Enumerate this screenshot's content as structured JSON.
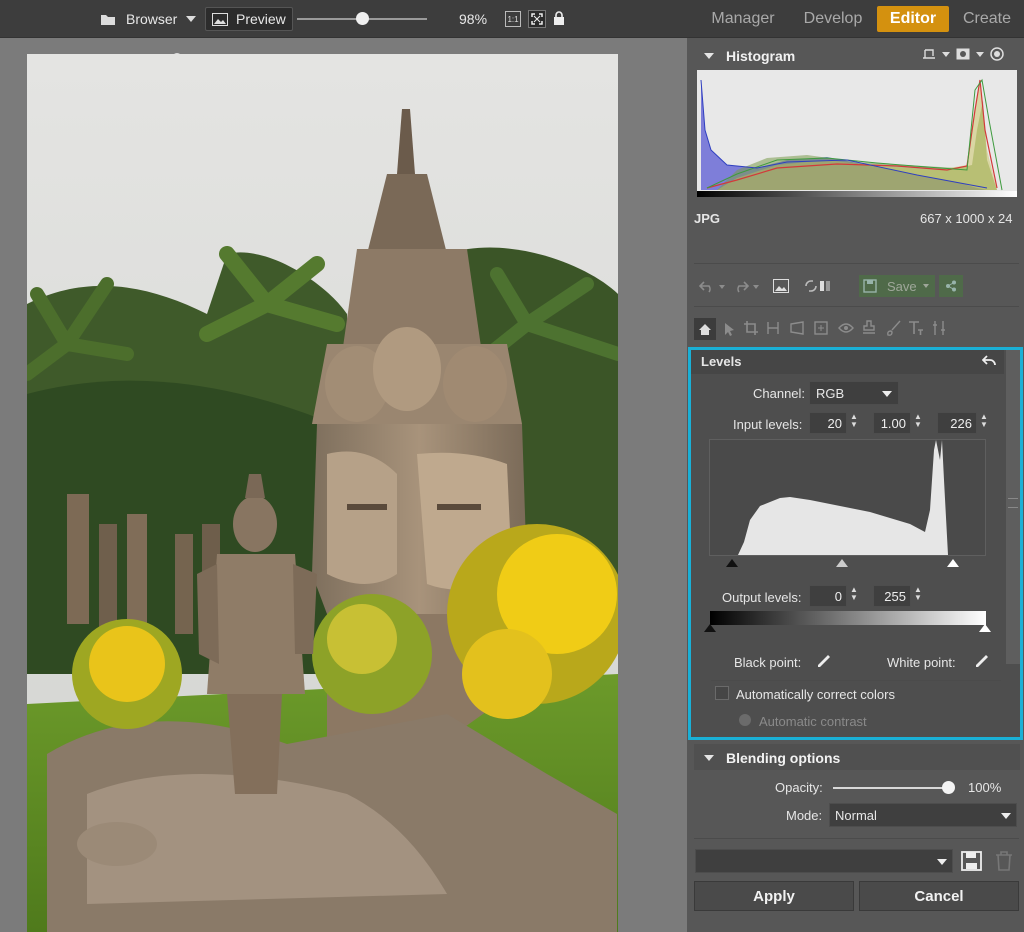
{
  "topbar": {
    "browser_label": "Browser",
    "preview_label": "Preview",
    "zoom": "98%",
    "zoom_slider_fraction": 0.5,
    "one_to_one_label": "1:1",
    "tabs": [
      {
        "label": "Manager",
        "active": false
      },
      {
        "label": "Develop",
        "active": false
      },
      {
        "label": "Editor",
        "active": true
      },
      {
        "label": "Create",
        "active": false
      }
    ],
    "accent_color": "#d4910f"
  },
  "histogram": {
    "title": "Histogram",
    "format": "JPG",
    "info": "667 x 1000 x 24"
  },
  "toolbar": {
    "save_label": "Save"
  },
  "levels": {
    "title": "Levels",
    "channel_label": "Channel:",
    "channel_value": "RGB",
    "input_label": "Input levels:",
    "input_black": "20",
    "input_mid": "1.00",
    "input_white": "226",
    "output_label": "Output levels:",
    "output_black": "0",
    "output_white": "255",
    "black_point_label": "Black point:",
    "white_point_label": "White point:",
    "auto_correct_label": "Automatically correct colors",
    "auto_contrast_label": "Automatic contrast",
    "highlight_color": "#1ab0d6"
  },
  "blending": {
    "title": "Blending options",
    "opacity_label": "Opacity:",
    "opacity_value": "100%",
    "opacity_fraction": 1.0,
    "mode_label": "Mode:",
    "mode_value": "Normal"
  },
  "footer": {
    "preset_value": "",
    "apply_label": "Apply",
    "cancel_label": "Cancel"
  }
}
